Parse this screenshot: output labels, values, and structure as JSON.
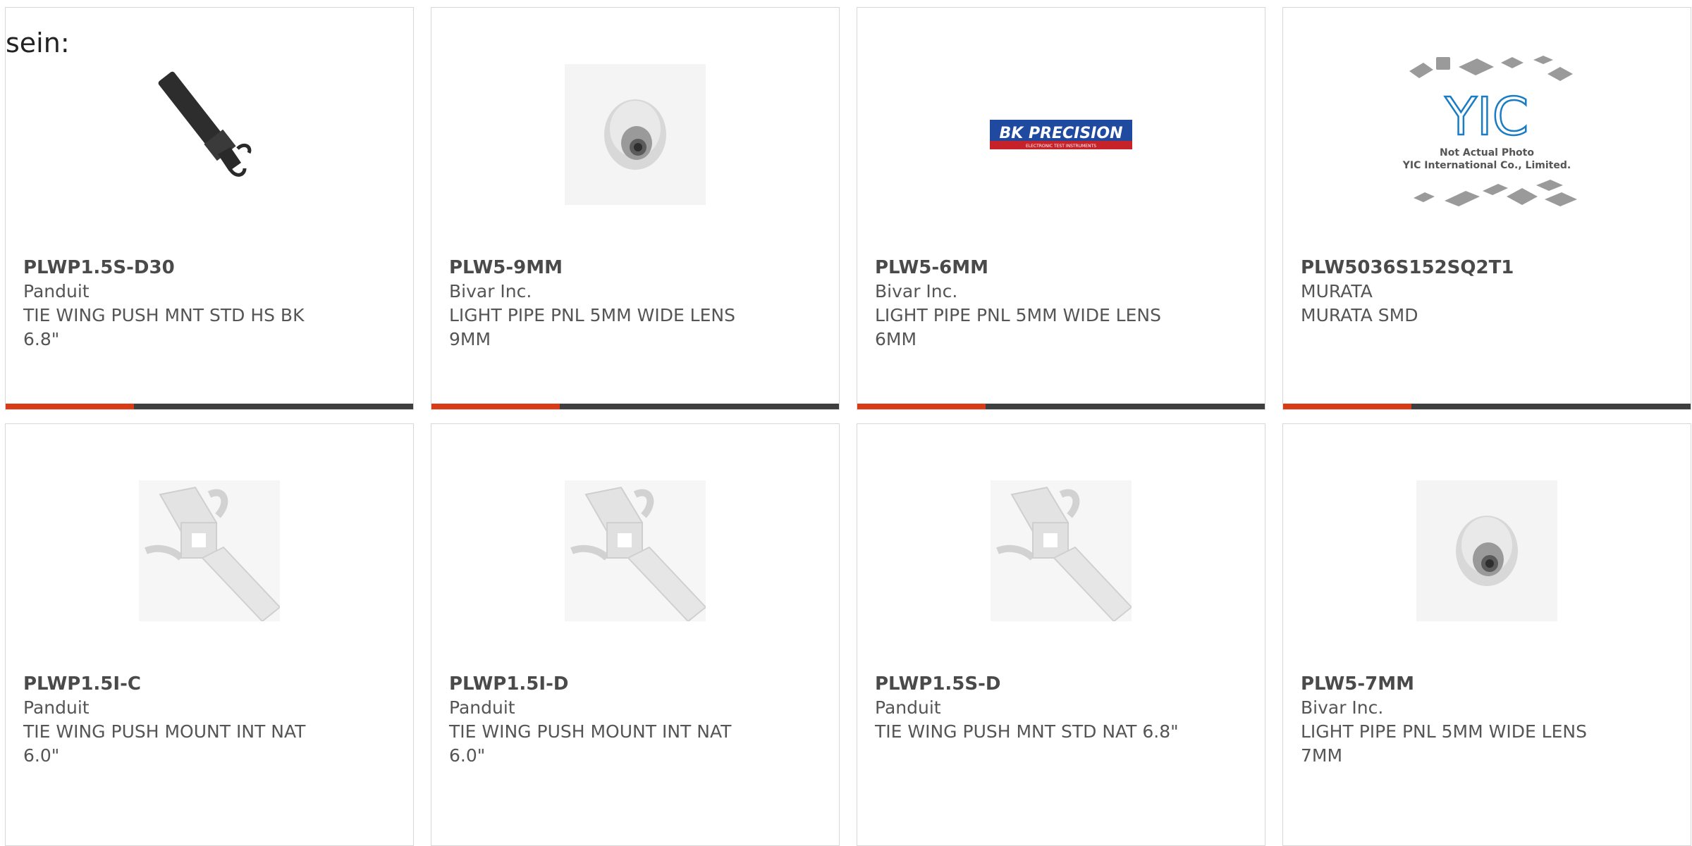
{
  "page_fragment": "sein:",
  "colors": {
    "accent": "#d93b17",
    "bar": "#3f3f3f",
    "border": "#d8d8d8",
    "text": "#555555"
  },
  "products": [
    {
      "part": "PLWP1.5S-D30",
      "manufacturer": "Panduit",
      "description": "TIE WING PUSH MNT STD HS BK 6.8\"",
      "image_icon": "black-cable-tie-wing-icon"
    },
    {
      "part": "PLW5-9MM",
      "manufacturer": "Bivar Inc.",
      "description": "LIGHT PIPE PNL 5MM WIDE LENS 9MM",
      "image_icon": "light-pipe-icon"
    },
    {
      "part": "PLW5-6MM",
      "manufacturer": "Bivar Inc.",
      "description": "LIGHT PIPE PNL 5MM WIDE LENS 6MM",
      "image_icon": "bk-precision-logo",
      "logo_text": "BK PRECISION",
      "logo_subtext": "ELECTRONIC TEST INSTRUMENTS"
    },
    {
      "part": "PLW5036S152SQ2T1",
      "manufacturer": "MURATA",
      "description": "MURATA SMD",
      "image_icon": "yic-not-actual-photo-logo",
      "logo_text": "YIC",
      "logo_caption_1": "Not Actual Photo",
      "logo_caption_2": "YIC International Co., Limited."
    },
    {
      "part": "PLWP1.5I-C",
      "manufacturer": "Panduit",
      "description": "TIE WING PUSH MOUNT INT NAT 6.0\"",
      "image_icon": "white-cable-tie-wing-icon"
    },
    {
      "part": "PLWP1.5I-D",
      "manufacturer": "Panduit",
      "description": "TIE WING PUSH MOUNT INT NAT 6.0\"",
      "image_icon": "white-cable-tie-wing-icon"
    },
    {
      "part": "PLWP1.5S-D",
      "manufacturer": "Panduit",
      "description": "TIE WING PUSH MNT STD NAT 6.8\"",
      "image_icon": "white-cable-tie-wing-icon"
    },
    {
      "part": "PLW5-7MM",
      "manufacturer": "Bivar Inc.",
      "description": "LIGHT PIPE PNL 5MM WIDE LENS 7MM",
      "image_icon": "light-pipe-icon"
    }
  ]
}
